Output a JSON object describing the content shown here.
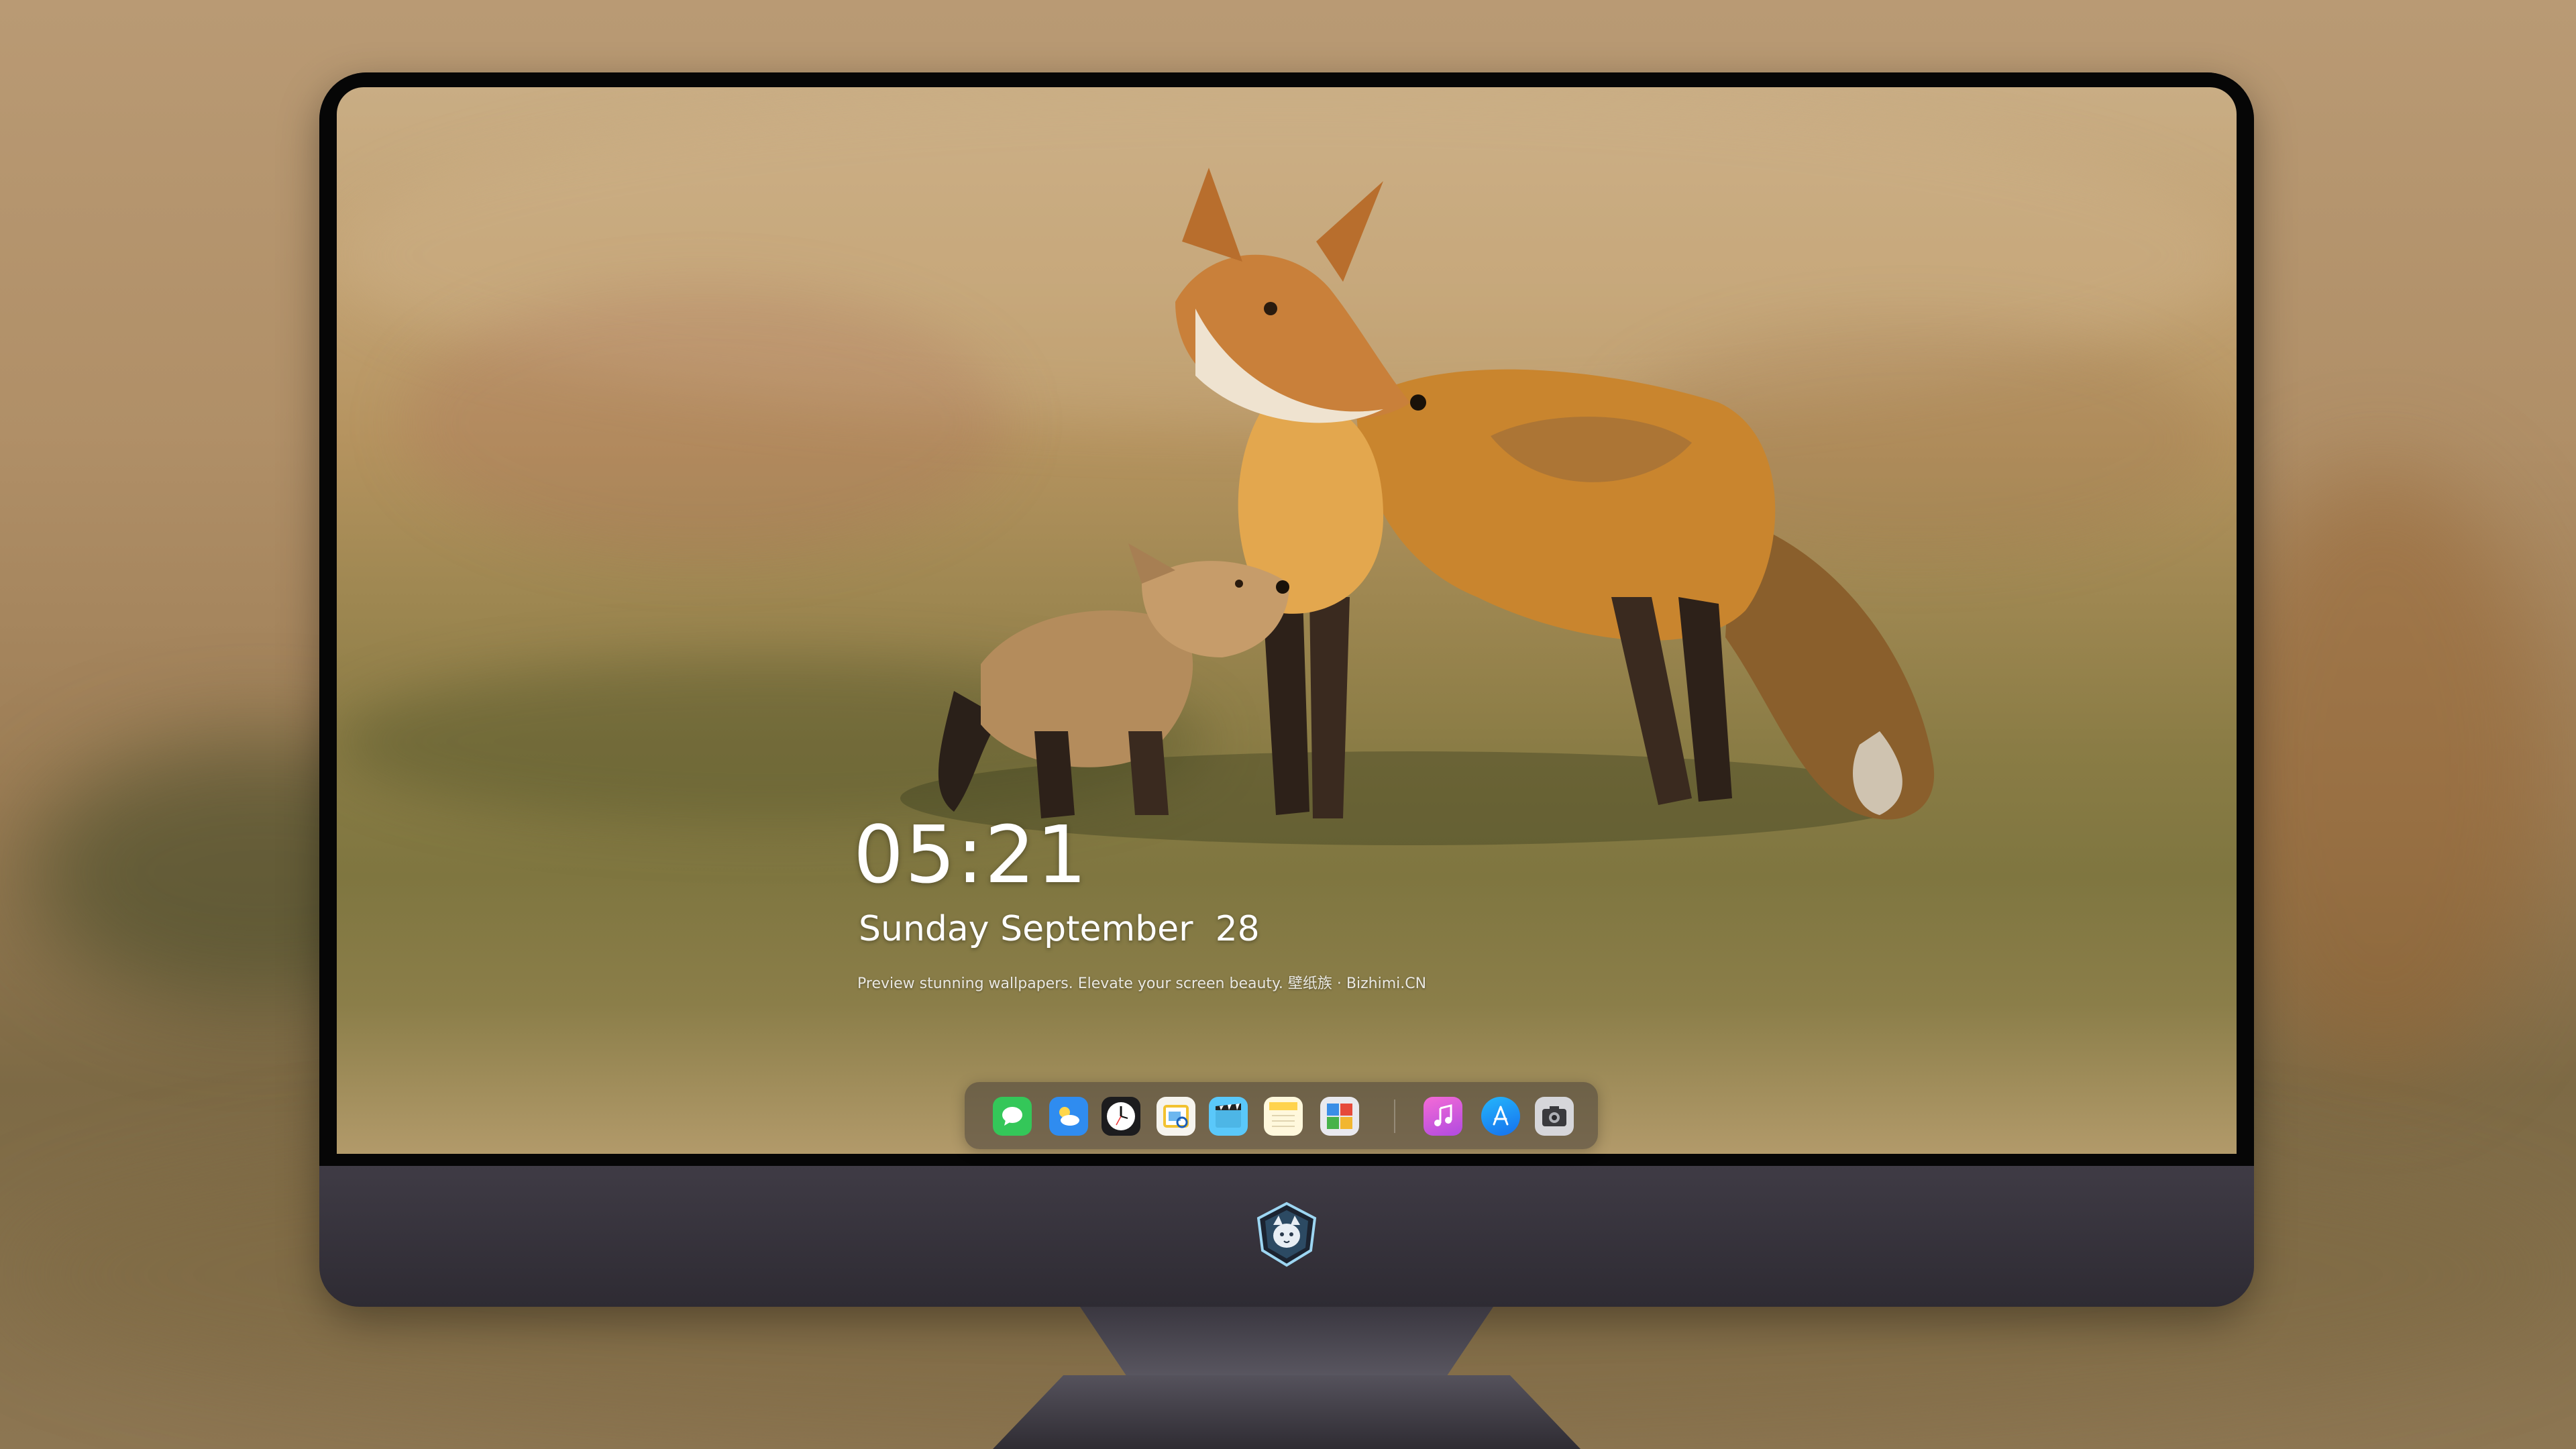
{
  "clock": {
    "time": "05:21",
    "date": "Sunday September  28",
    "tagline": "Preview stunning wallpapers. Elevate your screen beauty. 壁纸族 · Bizhimi.CN"
  },
  "dock": {
    "apps": [
      {
        "name": "messages-icon",
        "color": "#34c759"
      },
      {
        "name": "weather-icon",
        "color": "#2f8cf0"
      },
      {
        "name": "clock-icon",
        "color": "#1c1c1e"
      },
      {
        "name": "preview-icon",
        "color": "#f2c230"
      },
      {
        "name": "clips-icon",
        "color": "#5ac8fa"
      },
      {
        "name": "notes-icon",
        "color": "#ffd34d"
      },
      {
        "name": "photo-booth-icon",
        "color": "#e9e9ee"
      },
      {
        "name": "music-icon",
        "color": "#d85ad0"
      },
      {
        "name": "app-store-icon",
        "color": "#1a8cf2"
      },
      {
        "name": "camera-icon",
        "color": "#8e8e93"
      }
    ]
  },
  "branding": {
    "logo_icon": "wolf-shield-logo-icon"
  }
}
